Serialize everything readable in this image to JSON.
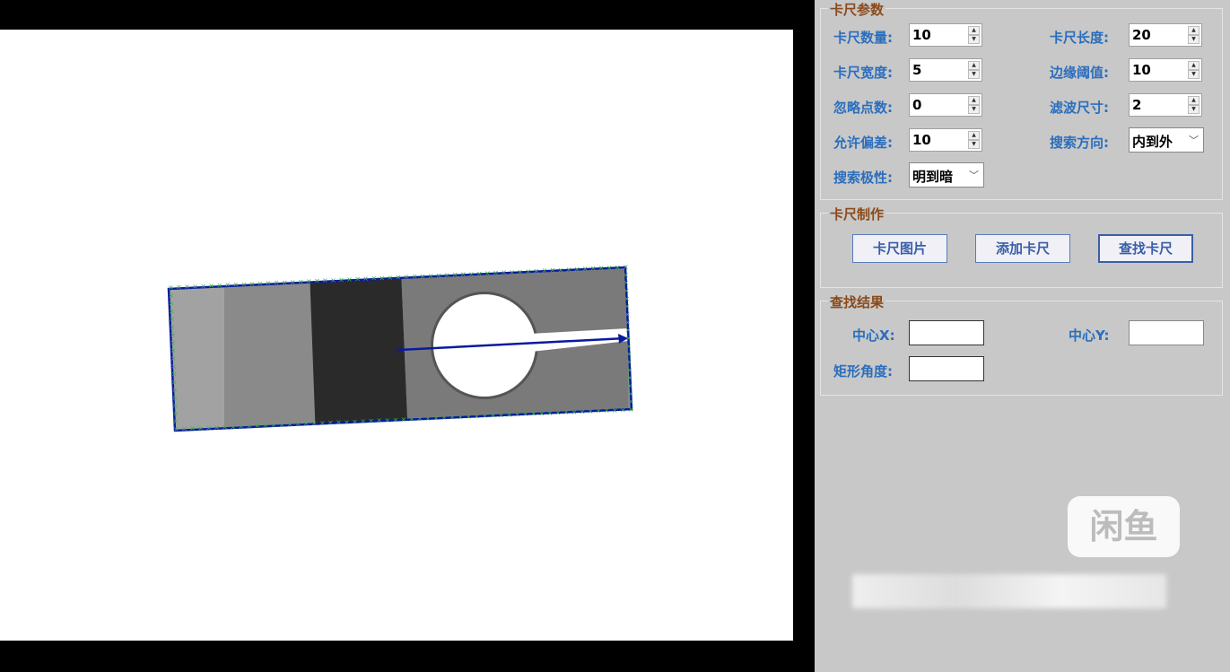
{
  "params": {
    "title": "卡尺参数",
    "fields": [
      {
        "label": "卡尺数量:",
        "value": "10"
      },
      {
        "label": "卡尺长度:",
        "value": "20"
      },
      {
        "label": "卡尺宽度:",
        "value": "5"
      },
      {
        "label": "边缘阈值:",
        "value": "10"
      },
      {
        "label": "忽略点数:",
        "value": "0"
      },
      {
        "label": "滤波尺寸:",
        "value": "2"
      },
      {
        "label": "允许偏差:",
        "value": "10"
      }
    ],
    "direction": {
      "label": "搜索方向:",
      "value": "内到外"
    },
    "polarity": {
      "label": "搜索极性:",
      "value": "明到暗"
    }
  },
  "make": {
    "title": "卡尺制作",
    "buttons": [
      "卡尺图片",
      "添加卡尺",
      "查找卡尺"
    ]
  },
  "result": {
    "title": "查找结果",
    "center_x": "中心X:",
    "center_y": "中心Y:",
    "angle": "矩形角度:"
  },
  "watermark": "闲鱼",
  "colors": {
    "rect": "#0a1aa0",
    "points": "#3cb44b",
    "label": "#2a6ebd",
    "group_title": "#8b4a1a"
  }
}
